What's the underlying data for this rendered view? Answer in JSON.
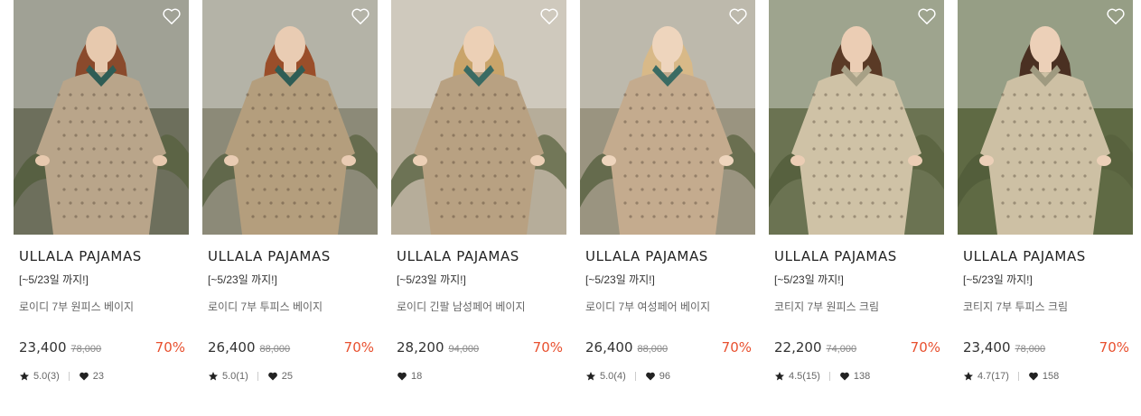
{
  "products": [
    {
      "brand": "ULLALA PAJAMAS",
      "promo": "[~5/23일 까지!]",
      "name": "로이디 7부 원피스 베이지",
      "price": "23,400",
      "original_price": "78,000",
      "discount": "70%",
      "rating": "5.0(3)",
      "likes": "23",
      "has_rating": true,
      "image": "model seated outdoors among plants, beige patterned long dress",
      "palette": {
        "bg": "#6d6f5c",
        "garment": "#b9a58a",
        "accent": "#2f5d55",
        "hair": "#8a4a2c",
        "skin": "#e7c9ae"
      }
    },
    {
      "brand": "ULLALA PAJAMAS",
      "promo": "[~5/23일 까지!]",
      "name": "로이디 7부 투피스 베이지",
      "price": "26,400",
      "original_price": "88,000",
      "discount": "70%",
      "rating": "5.0(1)",
      "likes": "25",
      "has_rating": true,
      "image": "model in beige patterned two-piece with lace collar",
      "palette": {
        "bg": "#8c8a78",
        "garment": "#b49e7d",
        "accent": "#2f5d55",
        "hair": "#9a4e2a",
        "skin": "#e9ccb3"
      }
    },
    {
      "brand": "ULLALA PAJAMAS",
      "promo": "[~5/23일 까지!]",
      "name": "로이디 긴팔 남성페어 베이지",
      "price": "28,200",
      "original_price": "94,000",
      "discount": "70%",
      "rating": "",
      "likes": "18",
      "has_rating": false,
      "image": "male model in beige pajama set with green collar",
      "palette": {
        "bg": "#b6ad9a",
        "garment": "#b8a182",
        "accent": "#3a6b63",
        "hair": "#c9a46a",
        "skin": "#ecd0b6"
      }
    },
    {
      "brand": "ULLALA PAJAMAS",
      "promo": "[~5/23일 까지!]",
      "name": "로이디 7부 여성페어 베이지",
      "price": "26,400",
      "original_price": "88,000",
      "discount": "70%",
      "rating": "5.0(4)",
      "likes": "96",
      "has_rating": true,
      "image": "female model in beige pajama set with green cuffs",
      "palette": {
        "bg": "#9a9480",
        "garment": "#c4ab8e",
        "accent": "#3a6b63",
        "hair": "#d8b988",
        "skin": "#eed5bd"
      }
    },
    {
      "brand": "ULLALA PAJAMAS",
      "promo": "[~5/23일 까지!]",
      "name": "코티지 7부 원피스 크림",
      "price": "22,200",
      "original_price": "74,000",
      "discount": "70%",
      "rating": "4.5(15)",
      "likes": "138",
      "has_rating": true,
      "image": "model in cream floral dress by railing with grasses",
      "palette": {
        "bg": "#6b7352",
        "garment": "#cfc2a6",
        "accent": "#a7a086",
        "hair": "#5a3a26",
        "skin": "#ebcdb4"
      }
    },
    {
      "brand": "ULLALA PAJAMAS",
      "promo": "[~5/23일 까지!]",
      "name": "코티지 7부 투피스 크림",
      "price": "23,400",
      "original_price": "78,000",
      "discount": "70%",
      "rating": "4.7(17)",
      "likes": "158",
      "has_rating": true,
      "image": "model seated in cream floral two-piece among greenery",
      "palette": {
        "bg": "#5f6a44",
        "garment": "#cdc0a4",
        "accent": "#9f9a80",
        "hair": "#4a3022",
        "skin": "#ecd0b8"
      }
    }
  ],
  "icons": {
    "wishlist": "heart-outline-icon",
    "star": "star-icon",
    "heart": "heart-filled-icon"
  },
  "colors": {
    "discount": "#e8502f"
  }
}
